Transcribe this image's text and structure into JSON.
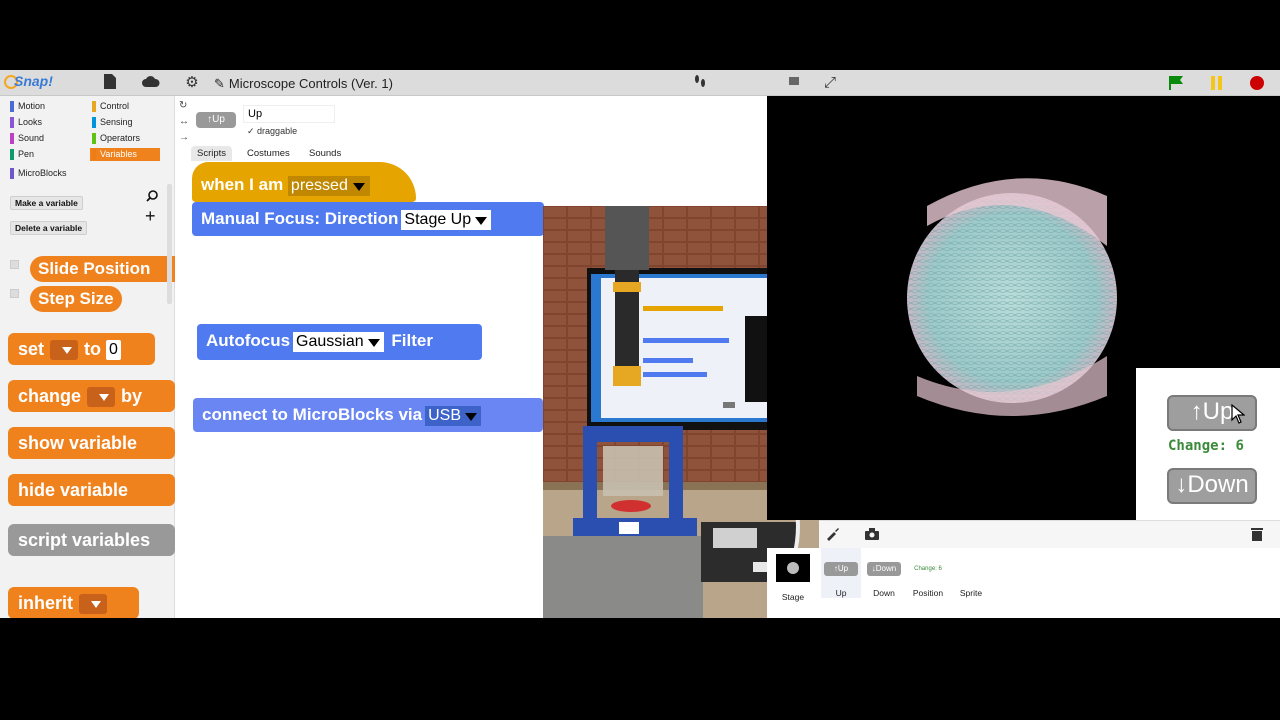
{
  "app": {
    "logo": "Snap!",
    "project_title": "Microscope Controls (Ver. 1)"
  },
  "palette": {
    "categories": [
      {
        "label": "Motion",
        "color": "#4a6cd4"
      },
      {
        "label": "Looks",
        "color": "#8a55d7"
      },
      {
        "label": "Sound",
        "color": "#bb42c3"
      },
      {
        "label": "Pen",
        "color": "#0e9a6c"
      },
      {
        "label": "Control",
        "color": "#e6a822"
      },
      {
        "label": "Sensing",
        "color": "#0494dc"
      },
      {
        "label": "Operators",
        "color": "#62c213"
      },
      {
        "label": "Variables",
        "color": "#ee7d16"
      },
      {
        "label": "MicroBlocks",
        "color": "#7055cc"
      }
    ],
    "make_variable": "Make a variable",
    "delete_variable": "Delete a variable",
    "vars": [
      "Slide Position",
      "Step Size"
    ],
    "blocks": {
      "set": "set",
      "to": "to",
      "set_value": "0",
      "change": "change",
      "by": "by",
      "show_variable": "show variable",
      "hide_variable": "hide variable",
      "script_variables": "script variables",
      "inherit": "inherit"
    }
  },
  "sprite": {
    "name": "Up",
    "thumb_label": "↑Up",
    "draggable_label": "draggable",
    "tabs": [
      "Scripts",
      "Costumes",
      "Sounds"
    ]
  },
  "scripts": {
    "hat": {
      "prefix": "when I am",
      "option": "pressed"
    },
    "manual_focus": {
      "label": "Manual Focus: Direction",
      "option": "Stage Up"
    },
    "autofocus": {
      "label": "Autofocus",
      "option": "Gaussian",
      "suffix": "Filter"
    },
    "connect": {
      "label": "connect to MicroBlocks via",
      "option": "USB"
    }
  },
  "stage": {
    "up_button": "↑Up",
    "down_button": "↓Down",
    "change_label": "Change:",
    "change_value": "6"
  },
  "corral": {
    "stage_label": "Stage",
    "sprites": [
      {
        "label": "Up",
        "thumb": "↑Up"
      },
      {
        "label": "Down",
        "thumb": "↓Down"
      },
      {
        "label": "Position",
        "thumb": "Change: 6"
      },
      {
        "label": "Sprite",
        "thumb": ""
      }
    ]
  }
}
